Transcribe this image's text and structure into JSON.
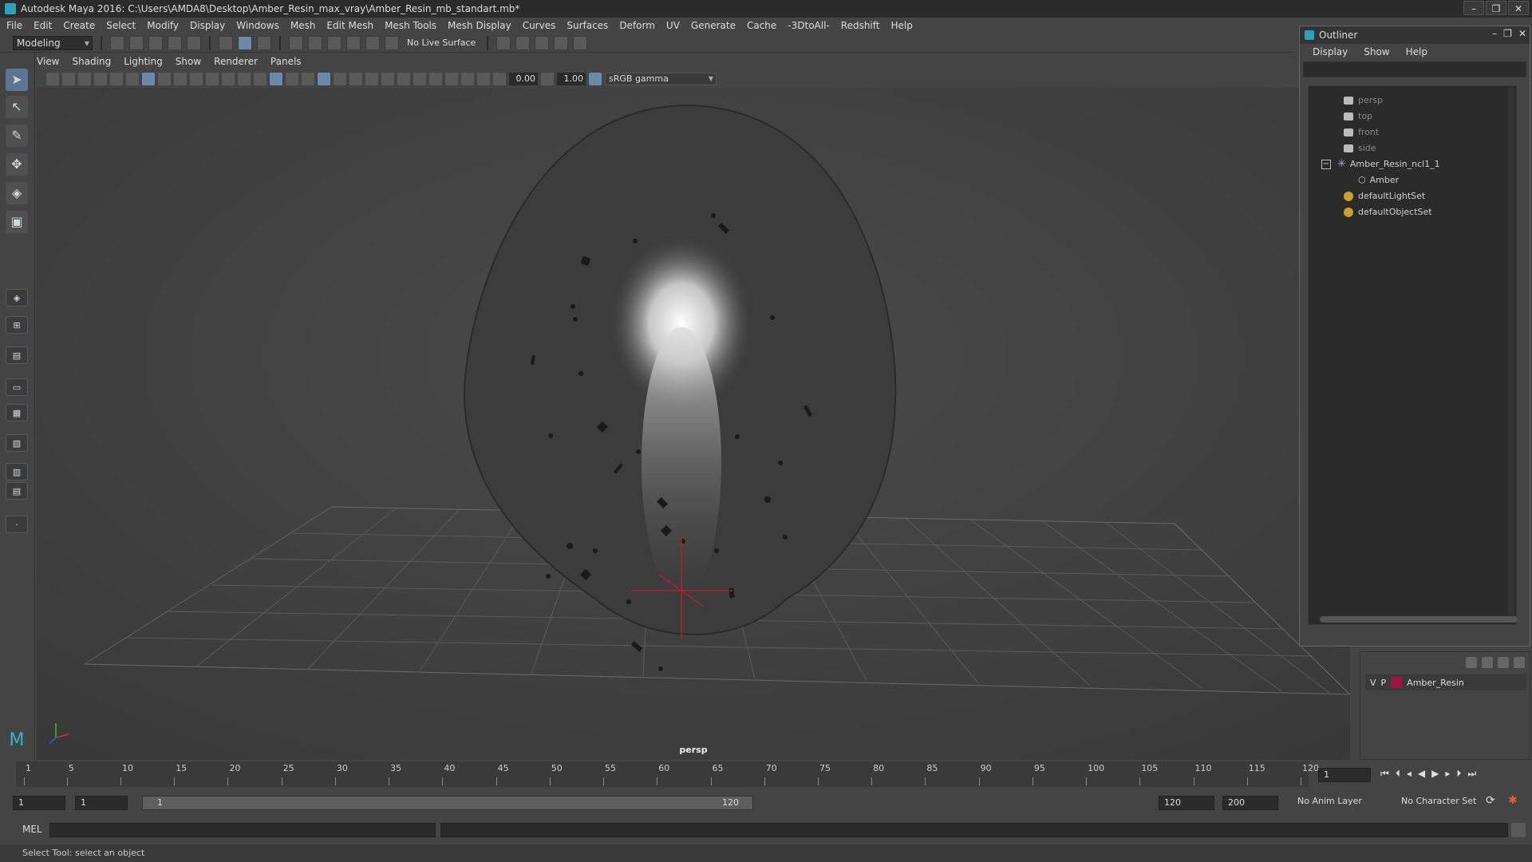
{
  "window": {
    "title": "Autodesk Maya 2016: C:\\Users\\AMDA8\\Desktop\\Amber_Resin_max_vray\\Amber_Resin_mb_standart.mb*",
    "buttons": [
      "–",
      "❐",
      "✕"
    ]
  },
  "menubar": [
    "File",
    "Edit",
    "Create",
    "Select",
    "Modify",
    "Display",
    "Windows",
    "Mesh",
    "Edit Mesh",
    "Mesh Tools",
    "Mesh Display",
    "Curves",
    "Surfaces",
    "Deform",
    "UV",
    "Generate",
    "Cache",
    "-3DtoAll-",
    "Redshift",
    "Help"
  ],
  "toolbar": {
    "mode": "Modeling",
    "live_surface": "No Live Surface"
  },
  "panel_menu": [
    "View",
    "Shading",
    "Lighting",
    "Show",
    "Renderer",
    "Panels"
  ],
  "viewport_toolbar": {
    "exposure": "0.00",
    "gamma_value": "1.00",
    "color_space": "sRGB gamma"
  },
  "viewport": {
    "camera_label": "persp"
  },
  "outliner": {
    "title": "Outliner",
    "window_buttons": [
      "–",
      "❐",
      "✕"
    ],
    "menu": [
      "Display",
      "Show",
      "Help"
    ],
    "items": [
      {
        "label": "persp"
      },
      {
        "label": "top"
      },
      {
        "label": "front"
      },
      {
        "label": "side"
      },
      {
        "label": "Amber_Resin_ncl1_1"
      },
      {
        "label": "Amber"
      },
      {
        "label": "defaultLightSet"
      },
      {
        "label": "defaultObjectSet"
      }
    ]
  },
  "layers": {
    "visible_flag": "V",
    "playback_flag": "P",
    "layer_name": "Amber_Resin",
    "layer_color": "#a0153e"
  },
  "timeline": {
    "ticks": [
      "1",
      "5",
      "10",
      "15",
      "20",
      "25",
      "30",
      "35",
      "40",
      "45",
      "50",
      "55",
      "60",
      "65",
      "70",
      "75",
      "80",
      "85",
      "90",
      "95",
      "100",
      "105",
      "110",
      "115",
      "120"
    ],
    "current_frame": "1"
  },
  "range": {
    "start_field": "1",
    "playback_start": "1",
    "slider_start": "1",
    "slider_end": "120",
    "playback_end": "120",
    "end_field": "200",
    "anim_layer": "No Anim Layer",
    "character_set": "No Character Set"
  },
  "command_line": {
    "label": "MEL"
  },
  "status": {
    "help_text": "Select Tool: select an object"
  }
}
